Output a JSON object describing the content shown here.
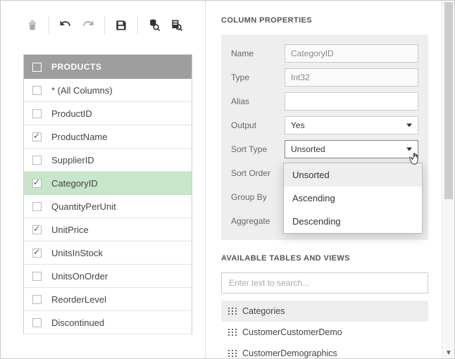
{
  "columns": {
    "header": "PRODUCTS",
    "items": [
      {
        "label": "* (All Columns)",
        "checked": false,
        "selected": false
      },
      {
        "label": "ProductID",
        "checked": false,
        "selected": false
      },
      {
        "label": "ProductName",
        "checked": true,
        "selected": false
      },
      {
        "label": "SupplierID",
        "checked": false,
        "selected": false
      },
      {
        "label": "CategoryID",
        "checked": true,
        "selected": true
      },
      {
        "label": "QuantityPerUnit",
        "checked": false,
        "selected": false
      },
      {
        "label": "UnitPrice",
        "checked": true,
        "selected": false
      },
      {
        "label": "UnitsInStock",
        "checked": true,
        "selected": false
      },
      {
        "label": "UnitsOnOrder",
        "checked": false,
        "selected": false
      },
      {
        "label": "ReorderLevel",
        "checked": false,
        "selected": false
      },
      {
        "label": "Discontinued",
        "checked": false,
        "selected": false
      }
    ]
  },
  "props": {
    "title": "COLUMN PROPERTIES",
    "labels": {
      "name": "Name",
      "type": "Type",
      "alias": "Alias",
      "output": "Output",
      "sort_type": "Sort Type",
      "sort_order": "Sort Order",
      "group_by": "Group By",
      "aggregate": "Aggregate"
    },
    "values": {
      "name": "CategoryID",
      "type": "Int32",
      "alias": "",
      "output": "Yes",
      "sort_type": "Unsorted"
    },
    "sort_type_options": [
      "Unsorted",
      "Ascending",
      "Descending"
    ]
  },
  "tables": {
    "title": "AVAILABLE TABLES AND VIEWS",
    "search_placeholder": "Enter text to search...",
    "items": [
      {
        "label": "Categories",
        "highlighted": true
      },
      {
        "label": "CustomerCustomerDemo",
        "highlighted": false
      },
      {
        "label": "CustomerDemographics",
        "highlighted": false
      }
    ]
  }
}
